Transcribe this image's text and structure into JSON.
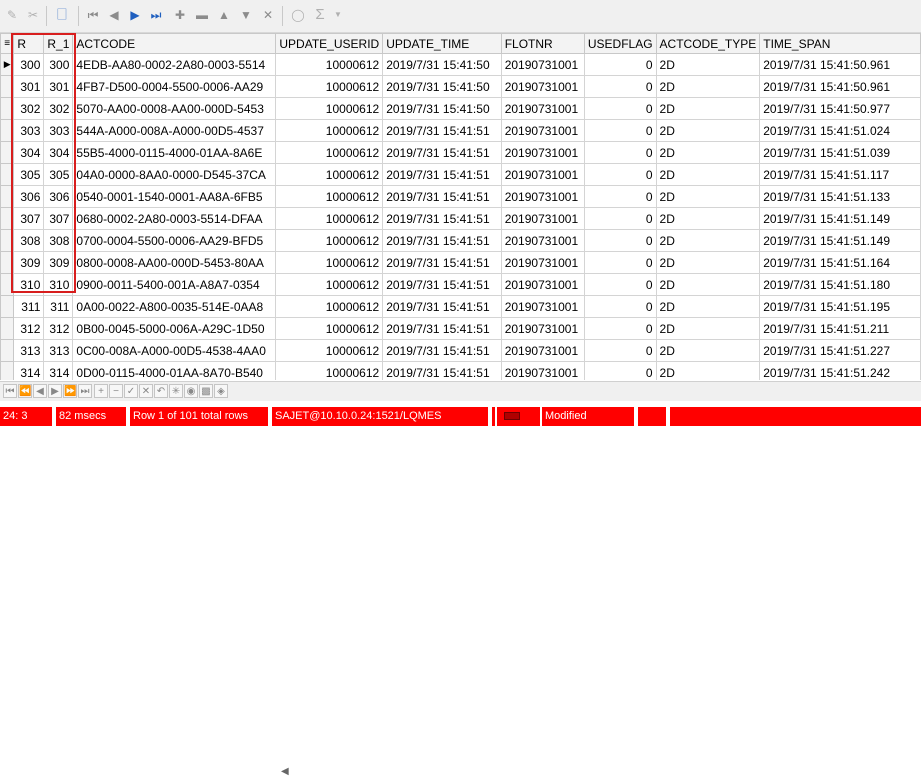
{
  "toolbar": {
    "icons": [
      "add-record-icon",
      "remove-record-icon",
      "refresh-icon",
      "first-record-icon",
      "prior-record-icon",
      "next-record-icon",
      "last-record-icon",
      "insert-icon",
      "delete-icon",
      "up-icon",
      "down-icon",
      "cancel-icon",
      "filter-icon",
      "sum-icon",
      "dropdown-icon"
    ]
  },
  "grid": {
    "columns": [
      "R",
      "R_1",
      "ACTCODE",
      "UPDATE_USERID",
      "UPDATE_TIME",
      "FLOTNR",
      "USEDFLAG",
      "ACTCODE_TYPE",
      "TIME_SPAN"
    ],
    "rows": [
      [
        "300",
        "300",
        "4EDB-AA80-0002-2A80-0003-5514",
        "10000612",
        "2019/7/31 15:41:50",
        "20190731001",
        "0",
        "2D",
        "2019/7/31 15:41:50.961"
      ],
      [
        "301",
        "301",
        "4FB7-D500-0004-5500-0006-AA29",
        "10000612",
        "2019/7/31 15:41:50",
        "20190731001",
        "0",
        "2D",
        "2019/7/31 15:41:50.961"
      ],
      [
        "302",
        "302",
        "5070-AA00-0008-AA00-000D-5453",
        "10000612",
        "2019/7/31 15:41:50",
        "20190731001",
        "0",
        "2D",
        "2019/7/31 15:41:50.977"
      ],
      [
        "303",
        "303",
        "544A-A000-008A-A000-00D5-4537",
        "10000612",
        "2019/7/31 15:41:51",
        "20190731001",
        "0",
        "2D",
        "2019/7/31 15:41:51.024"
      ],
      [
        "304",
        "304",
        "55B5-4000-0115-4000-01AA-8A6E",
        "10000612",
        "2019/7/31 15:41:51",
        "20190731001",
        "0",
        "2D",
        "2019/7/31 15:41:51.039"
      ],
      [
        "305",
        "305",
        "04A0-0000-8AA0-0000-D545-37CA",
        "10000612",
        "2019/7/31 15:41:51",
        "20190731001",
        "0",
        "2D",
        "2019/7/31 15:41:51.117"
      ],
      [
        "306",
        "306",
        "0540-0001-1540-0001-AA8A-6FB5",
        "10000612",
        "2019/7/31 15:41:51",
        "20190731001",
        "0",
        "2D",
        "2019/7/31 15:41:51.133"
      ],
      [
        "307",
        "307",
        "0680-0002-2A80-0003-5514-DFAA",
        "10000612",
        "2019/7/31 15:41:51",
        "20190731001",
        "0",
        "2D",
        "2019/7/31 15:41:51.149"
      ],
      [
        "308",
        "308",
        "0700-0004-5500-0006-AA29-BFD5",
        "10000612",
        "2019/7/31 15:41:51",
        "20190731001",
        "0",
        "2D",
        "2019/7/31 15:41:51.149"
      ],
      [
        "309",
        "309",
        "0800-0008-AA00-000D-5453-80AA",
        "10000612",
        "2019/7/31 15:41:51",
        "20190731001",
        "0",
        "2D",
        "2019/7/31 15:41:51.164"
      ],
      [
        "310",
        "310",
        "0900-0011-5400-001A-A8A7-0354",
        "10000612",
        "2019/7/31 15:41:51",
        "20190731001",
        "0",
        "2D",
        "2019/7/31 15:41:51.180"
      ],
      [
        "311",
        "311",
        "0A00-0022-A800-0035-514E-0AA8",
        "10000612",
        "2019/7/31 15:41:51",
        "20190731001",
        "0",
        "2D",
        "2019/7/31 15:41:51.195"
      ],
      [
        "312",
        "312",
        "0B00-0045-5000-006A-A29C-1D50",
        "10000612",
        "2019/7/31 15:41:51",
        "20190731001",
        "0",
        "2D",
        "2019/7/31 15:41:51.211"
      ],
      [
        "313",
        "313",
        "0C00-008A-A000-00D5-4538-4AA0",
        "10000612",
        "2019/7/31 15:41:51",
        "20190731001",
        "0",
        "2D",
        "2019/7/31 15:41:51.227"
      ],
      [
        "314",
        "314",
        "0D00-0115-4000-01AA-8A70-B540",
        "10000612",
        "2019/7/31 15:41:51",
        "20190731001",
        "0",
        "2D",
        "2019/7/31 15:41:51.242"
      ]
    ]
  },
  "navbar": {
    "icons": [
      "nav-first-icon",
      "nav-prev-page-icon",
      "nav-prev-icon",
      "nav-next-icon",
      "nav-next-page-icon",
      "nav-last-icon",
      "nav-insert-icon",
      "nav-delete-icon",
      "nav-edit-icon",
      "nav-post-icon",
      "nav-cancel-icon",
      "nav-refresh-icon",
      "nav-bookmark-icon",
      "nav-goto-icon",
      "nav-filter-icon"
    ]
  },
  "status": {
    "position": "24:  3",
    "time": "82 msecs",
    "rows": "Row 1 of 101 total rows",
    "connection": "SAJET@10.10.0.24:1521/LQMES",
    "state": "Modified"
  },
  "colors": {
    "status_bg": "#ff0000",
    "highlight_box": "#d81e1e"
  }
}
